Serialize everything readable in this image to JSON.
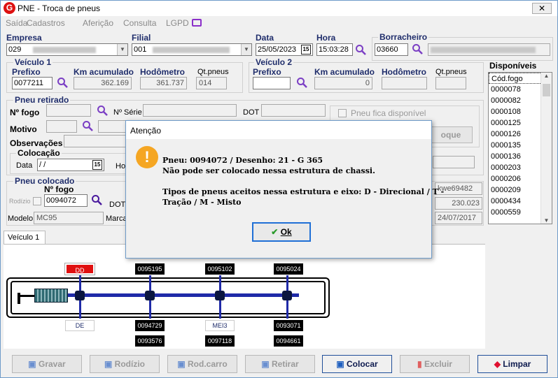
{
  "window": {
    "title": "PNE - Troca de pneus",
    "close": "✕"
  },
  "menu": [
    "Saída",
    "Cadastros",
    "Aferição",
    "Consulta",
    "LGPD"
  ],
  "header": {
    "empresa_label": "Empresa",
    "empresa_code": "029",
    "filial_label": "Filial",
    "filial_code": "001",
    "data_label": "Data",
    "data_value": "25/05/2023",
    "hora_label": "Hora",
    "hora_value": "15:03:28",
    "borracheiro_label": "Borracheiro",
    "borracheiro_code": "03660",
    "cal_icon": "15"
  },
  "veiculo1": {
    "title": "Veículo 1",
    "prefixo_label": "Prefixo",
    "prefixo": "0077211",
    "km_label": "Km acumulado",
    "km": "362.169",
    "hod_label": "Hodômetro",
    "hod": "361.737",
    "qt_label": "Qt.pneus",
    "qt": "014"
  },
  "veiculo2": {
    "title": "Veículo 2",
    "prefixo_label": "Prefixo",
    "prefixo": "",
    "km_label": "Km acumulado",
    "km": "0",
    "hod_label": "Hodômetro",
    "hod": "",
    "qt_label": "Qt.pneus",
    "qt": ""
  },
  "disponiveis": {
    "title": "Disponíveis",
    "items": [
      "Cód.fogo",
      "0000078",
      "0000082",
      "0000108",
      "0000125",
      "0000126",
      "0000135",
      "0000136",
      "0000203",
      "0000206",
      "0000209",
      "0000434",
      "0000559"
    ]
  },
  "retirado": {
    "title": "Pneu retirado",
    "fogo_label": "Nº fogo",
    "serie_label": "Nº Série",
    "dot_label": "DOT",
    "disp_label": "Pneu fica disponível",
    "motivo_label": "Motivo",
    "obs_label": "Observações",
    "estoque_btn": "oque",
    "colocacao_title": "Colocação",
    "data_label": "Data",
    "data_value": " /  /",
    "ho_label": "Ho"
  },
  "colocado": {
    "title": "Pneu colocado",
    "fogo_label": "Nº fogo",
    "fogo": "0094072",
    "rodizio_label": "Rodízio",
    "dot_label": "DOT",
    "modelo_label": "Modelo",
    "modelo": "MC95",
    "marca_label": "Marca",
    "right1": "kwe69482",
    "right2": "230.023",
    "right3": "24/07/2017"
  },
  "tab": {
    "label": "Veículo 1"
  },
  "diagram": {
    "top": [
      "DD",
      "0095195",
      "0095102",
      "0095024"
    ],
    "bottom1": [
      "DE",
      "0094729",
      "MEI3",
      "0093071"
    ],
    "bottom2": [
      "0093576",
      "0097118",
      "0094661"
    ]
  },
  "buttons": {
    "gravar": "Gravar",
    "rodizio": "Rodízio",
    "rodcarro": "Rod.carro",
    "retirar": "Retirar",
    "colocar": "Colocar",
    "excluir": "Excluir",
    "limpar": "Limpar"
  },
  "dialog": {
    "title": "Atenção",
    "icon": "!",
    "line1": "Pneu: 0094072 / Desenho: 21 - G 365",
    "line2": "Não pode ser colocado nessa estrutura de chassi.",
    "line3": "Tipos de pneus aceitos nessa estrutura e eixo: D - Direcional / T -",
    "line4": "Tração / M - Misto",
    "ok": "Ok"
  },
  "colors": {
    "accent": "#1f2d6b",
    "warning": "#f5a623",
    "danger": "#e01010",
    "tire": "#000000"
  }
}
